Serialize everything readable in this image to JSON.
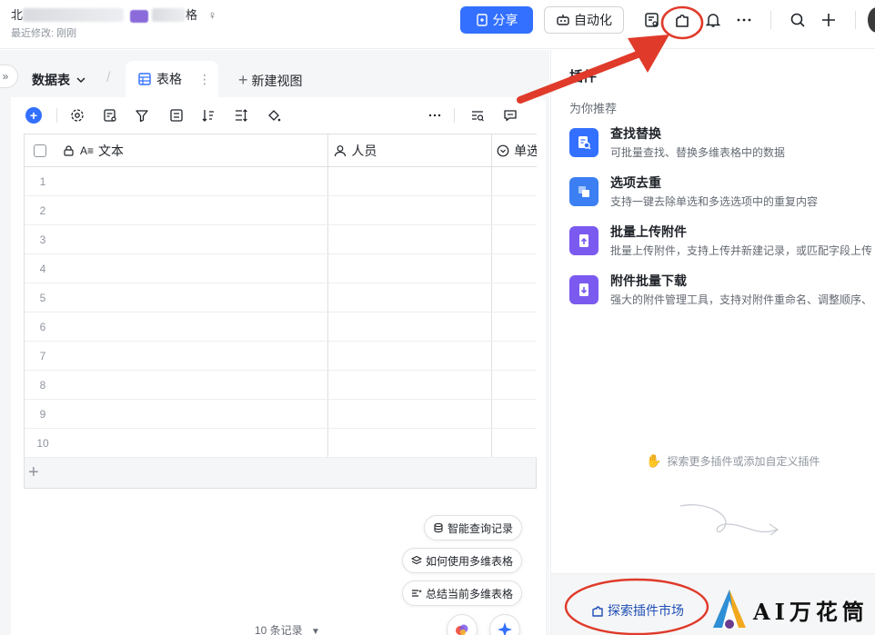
{
  "header": {
    "title_visible": "北",
    "title_end": "格",
    "pin_glyph": "♀",
    "last_modified": "最近修改: 刚刚",
    "share_label": "分享",
    "automation_label": "自动化"
  },
  "left": {
    "table_name": "数据表",
    "view_tab_label": "表格",
    "new_view_label": "新建视图",
    "columns": [
      "文本",
      "人员",
      "单选"
    ],
    "rows": [
      "1",
      "2",
      "3",
      "4",
      "5",
      "6",
      "7",
      "8",
      "9",
      "10"
    ],
    "add_row_glyph": "+",
    "chips": {
      "smart_query": "智能查询记录",
      "how_to_use": "如何使用多维表格",
      "summarize": "总结当前多维表格"
    },
    "record_count": "10 条记录"
  },
  "plugins": {
    "panel_title": "插件",
    "recommended_label": "为你推荐",
    "items": [
      {
        "name": "查找替换",
        "desc": "可批量查找、替换多维表格中的数据"
      },
      {
        "name": "选项去重",
        "desc": "支持一键去除单选和多选选项中的重复内容"
      },
      {
        "name": "批量上传附件",
        "desc": "批量上传附件，支持上传并新建记录，或匹配字段上传"
      },
      {
        "name": "附件批量下载",
        "desc": "强大的附件管理工具，支持对附件重命名、调整顺序、"
      }
    ],
    "explore_hint": "探索更多插件或添加自定义插件",
    "market_label": "探索插件市场"
  },
  "watermark": {
    "text": "AI万花筒"
  },
  "colors": {
    "accent": "#3370ff",
    "annotation_red": "#e03a2a"
  }
}
